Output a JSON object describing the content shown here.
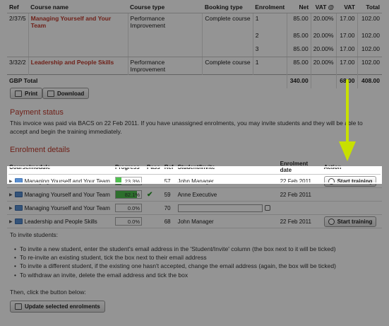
{
  "invoice": {
    "headers": [
      "Ref",
      "Course name",
      "Course type",
      "Booking type",
      "Enrolment",
      "Net",
      "VAT @",
      "VAT",
      "Total"
    ],
    "rows": [
      {
        "ref": "2/37/5",
        "course": "Managing Yourself and Your Team",
        "type": "Performance Improvement",
        "booking": "Complete course",
        "enrolment": "1",
        "net": "85.00",
        "vat_rate": "20.00%",
        "vat": "17.00",
        "total": "102.00"
      },
      {
        "ref": "",
        "course": "",
        "type": "",
        "booking": "",
        "enrolment": "2",
        "net": "85.00",
        "vat_rate": "20.00%",
        "vat": "17.00",
        "total": "102.00"
      },
      {
        "ref": "",
        "course": "",
        "type": "",
        "booking": "",
        "enrolment": "3",
        "net": "85.00",
        "vat_rate": "20.00%",
        "vat": "17.00",
        "total": "102.00"
      },
      {
        "ref": "3/32/2",
        "course": "Leadership and People Skills",
        "type": "Performance Improvement",
        "booking": "Complete course",
        "enrolment": "1",
        "net": "85.00",
        "vat_rate": "20.00%",
        "vat": "17.00",
        "total": "102.00"
      }
    ],
    "total": {
      "label": "GBP Total",
      "net": "340.00",
      "vat": "68.00",
      "total": "408.00"
    }
  },
  "buttons": {
    "print": "Print",
    "download": "Download",
    "update": "Update selected enrolments"
  },
  "payment": {
    "heading": "Payment status",
    "text": "This invoice was paid via BACS on 22 Feb 2011. If you have unassigned enrolments, you may invite students and they will be able to accept and begin the training immediately."
  },
  "enrolment": {
    "heading": "Enrolment details",
    "headers": [
      "Course/module",
      "Progress",
      "Pass",
      "Ref",
      "Student/Invite",
      "Enrolment date",
      "Action"
    ],
    "rows": [
      {
        "course": "Managing Yourself and Your Team",
        "progress_label": "23.3%",
        "progress": 0.233,
        "pass": "",
        "ref": "57",
        "student": "John Manager",
        "date": "22 Feb 2011",
        "action": "Start training",
        "highlighted": true
      },
      {
        "course": "Managing Yourself and Your Team",
        "progress_label": "82.1%",
        "progress": 0.821,
        "pass": "✔",
        "ref": "59",
        "student": "Anne Executive",
        "date": "22 Feb 2011",
        "action": ""
      },
      {
        "course": "Managing Yourself and Your Team",
        "progress_label": "0.0%",
        "progress": 0.0,
        "pass": "",
        "ref": "70",
        "student": "",
        "date": "",
        "action": "",
        "invite_field": true
      },
      {
        "course": "Leadership and People Skills",
        "progress_label": "0.0%",
        "progress": 0.0,
        "pass": "",
        "ref": "68",
        "student": "John Manager",
        "date": "22 Feb 2011",
        "action": "Start training"
      }
    ]
  },
  "instructions": {
    "intro": "To invite students:",
    "bullets": [
      "To invite a new student, enter the student's email address in the 'Student/Invite' column (the box next to it will be ticked)",
      "To re-invite an existing student, tick the box next to their email address",
      "To invite a different student, if the existing one hasn't accepted, change the email address (again, the box will be ticked)",
      "To withdraw an invite, delete the email address and tick the box"
    ],
    "outro": "Then, click the button below:"
  },
  "colors": {
    "heading": "#c0392b",
    "arrow": "#c8e000",
    "progress": "#4fc04f"
  }
}
